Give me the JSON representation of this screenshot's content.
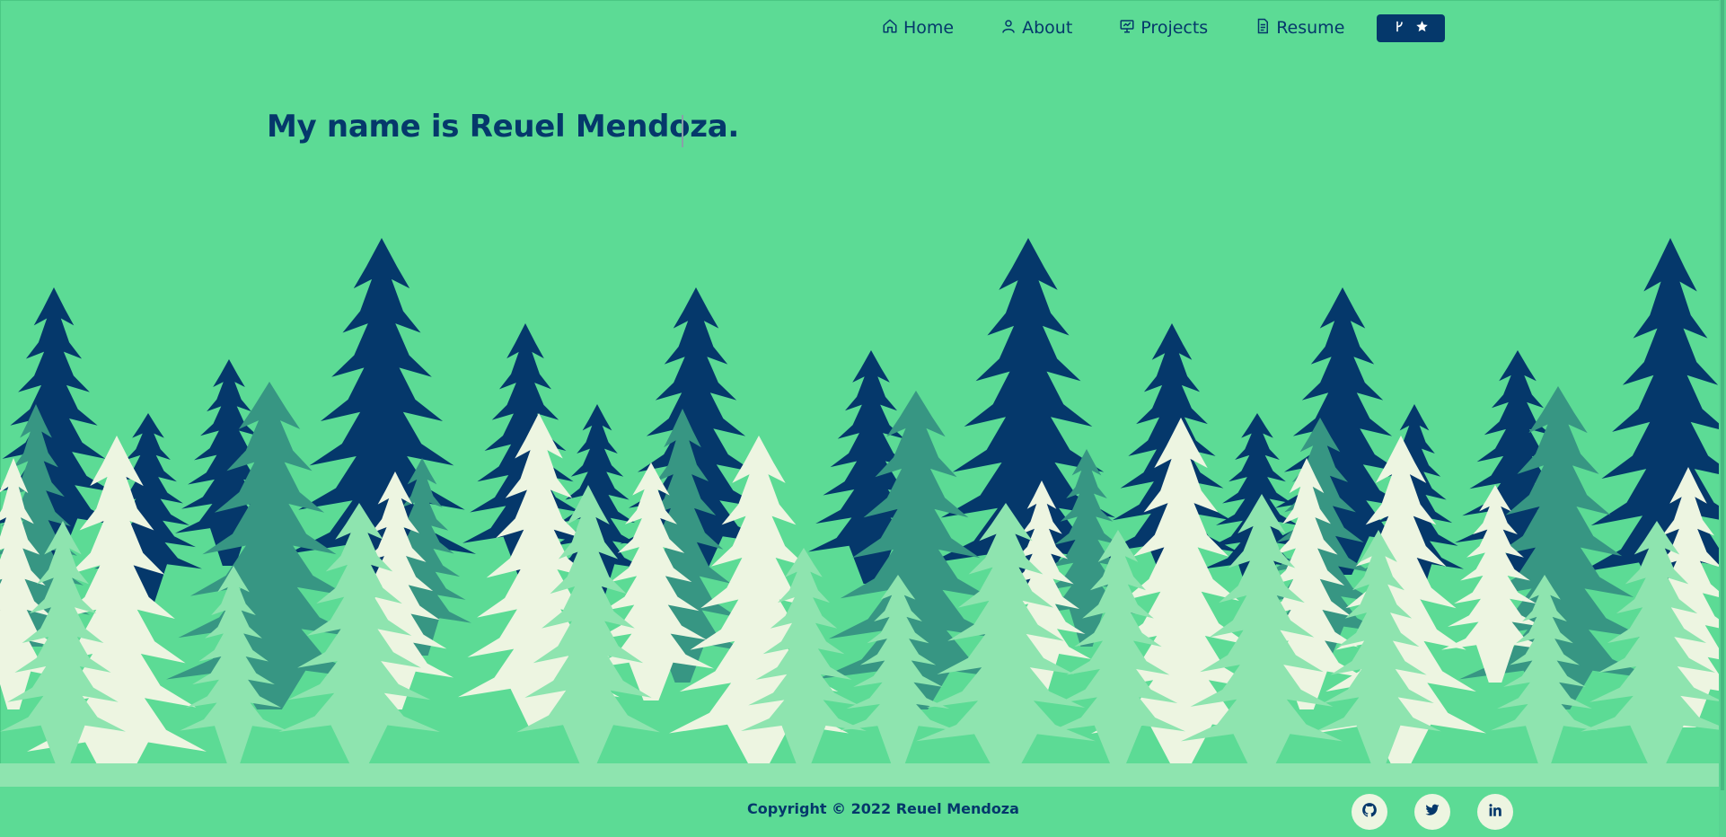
{
  "nav": {
    "items": [
      {
        "label": "Home",
        "icon": "home-icon"
      },
      {
        "label": "About",
        "icon": "user-icon"
      },
      {
        "label": "Projects",
        "icon": "presentation-icon"
      },
      {
        "label": "Resume",
        "icon": "document-icon"
      }
    ],
    "github_button": {
      "icons": [
        "git-fork-icon",
        "star-icon"
      ]
    }
  },
  "hero": {
    "title": "My name is Reuel Mendoza."
  },
  "footer": {
    "copyright": "Copyright © 2022 Reuel Mendoza",
    "social": [
      {
        "icon": "github-icon"
      },
      {
        "icon": "twitter-icon"
      },
      {
        "icon": "linkedin-icon"
      }
    ]
  },
  "colors": {
    "background": "#5cdb95",
    "primary": "#05386b",
    "teal": "#379683",
    "light": "#edf5e1",
    "pale_green": "#8ee4af"
  }
}
